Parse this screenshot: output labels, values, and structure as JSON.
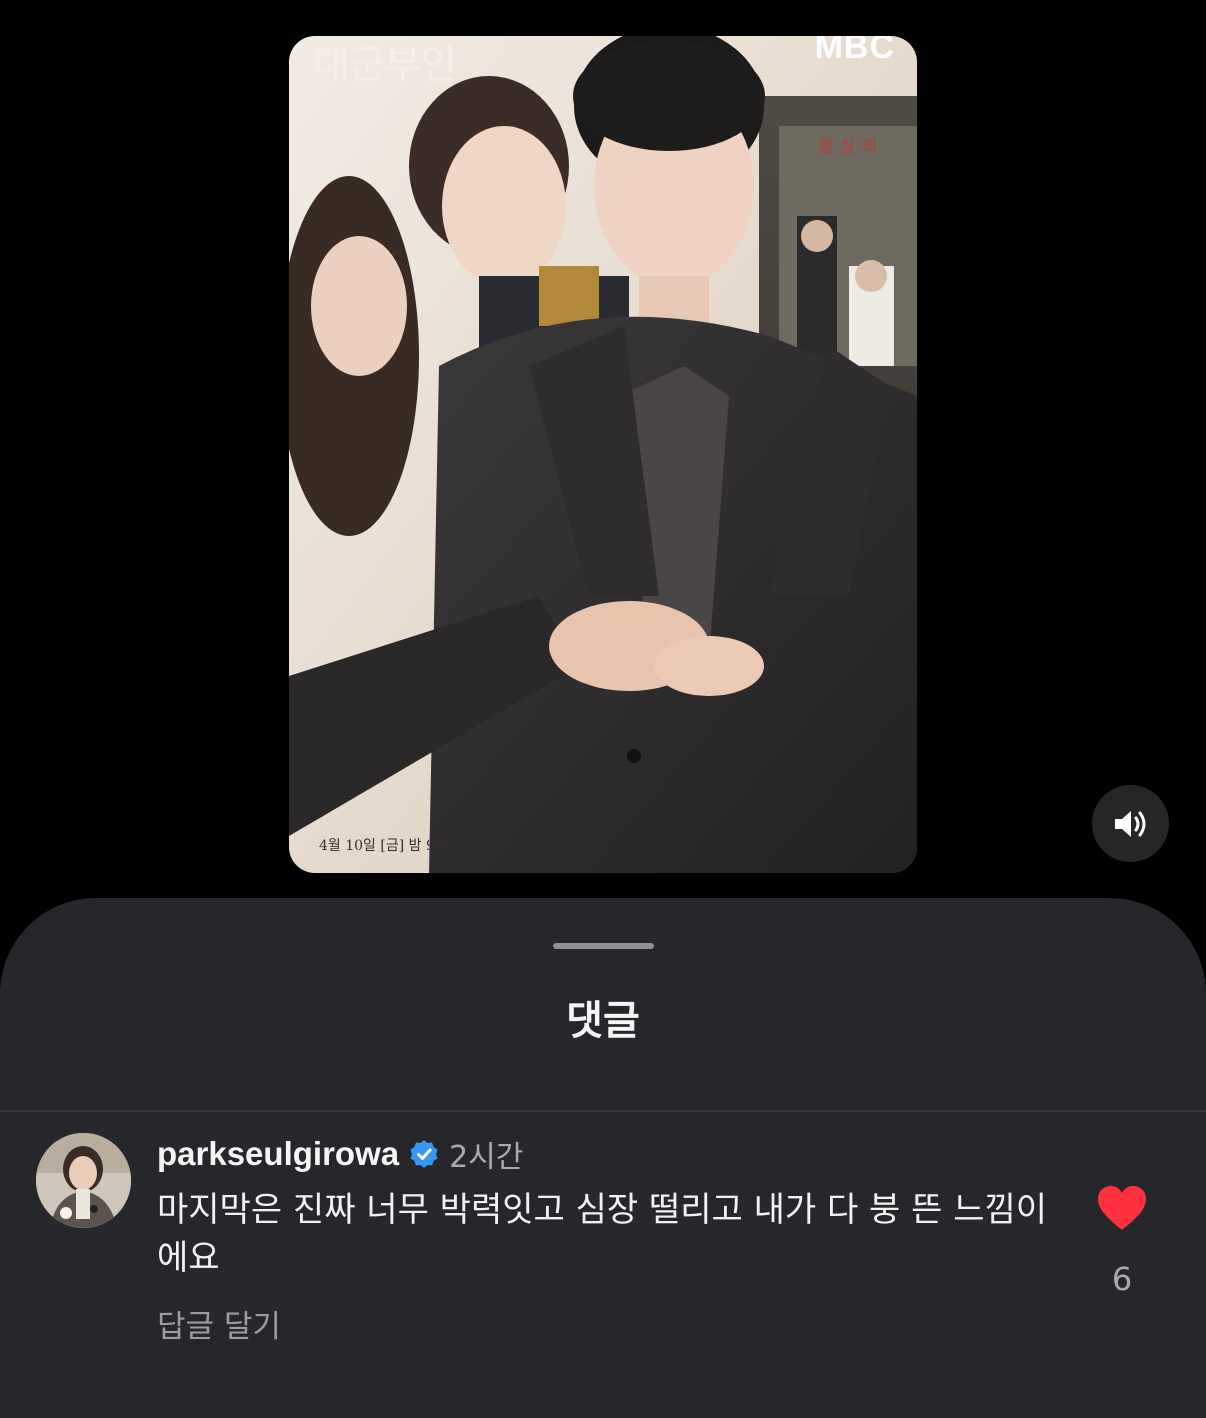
{
  "video": {
    "overlay_title": "대군부인",
    "overlay_brand": "MBC",
    "poster_vertical_text": "왕실의",
    "poster_date": "4월 10일 [금] 밤 9시"
  },
  "sound": {
    "icon": "speaker-on-icon"
  },
  "comments_sheet": {
    "title": "댓글",
    "comments": [
      {
        "username": "parkseulgirowa",
        "verified": true,
        "time": "2시간",
        "text": "마지막은 진짜 너무 박력잇고 심장 떨리고 내가 다 붕 뜬 느낌이에요",
        "reply_label": "답글 달기",
        "likes": "6",
        "liked": true
      }
    ]
  },
  "colors": {
    "background": "#000000",
    "sheet": "#25272b",
    "verified_badge": "#3897f0",
    "like_heart": "#ff3040",
    "muted_text": "#a8aaaf"
  }
}
